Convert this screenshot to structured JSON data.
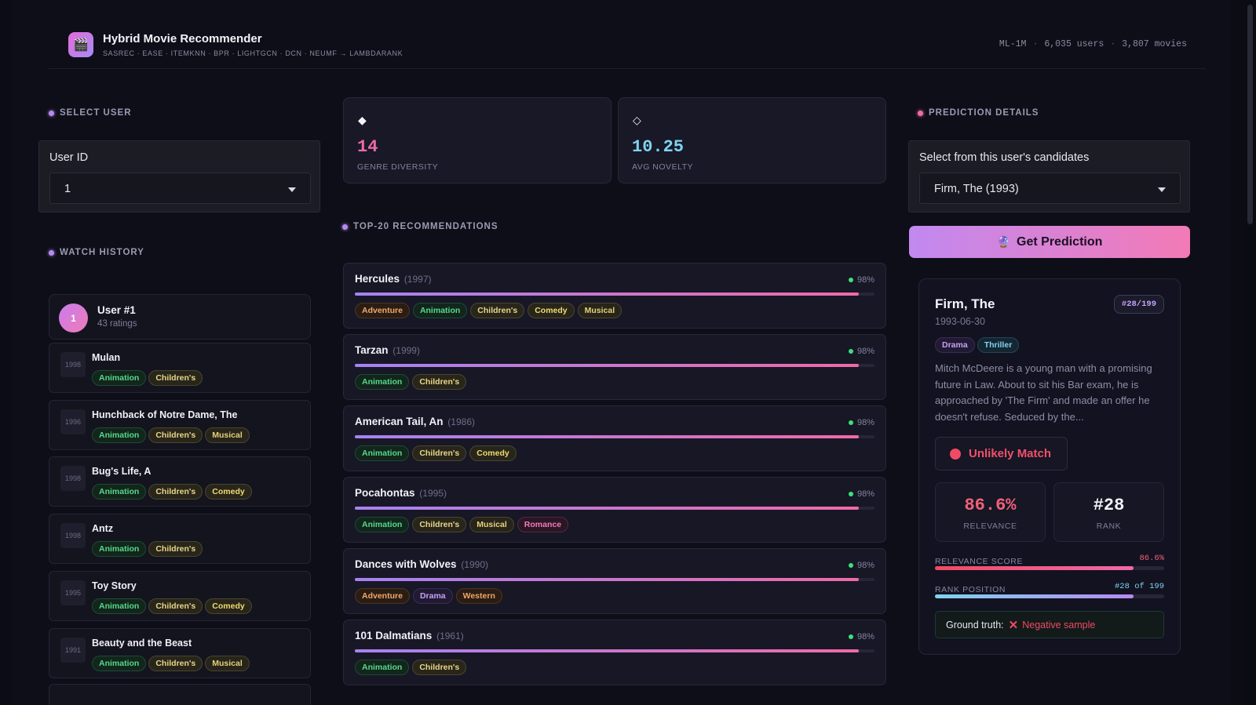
{
  "header": {
    "logo_icon": "clapper-board-icon",
    "title": "Hybrid Movie Recommender",
    "subtitle": "SASREC · EASE · ITEMKNN · BPR · LIGHTGCN · DCN · NEUMF → LAMBDARANK",
    "dataset": "ML-1M",
    "users": "6,035 users",
    "movies": "3,807 movies"
  },
  "left": {
    "select_user_label": "SELECT USER",
    "user_id_label": "User ID",
    "user_id_value": "1",
    "watch_history_label": "WATCH HISTORY",
    "user": {
      "avatar": "1",
      "name": "User #1",
      "ratings": "43 ratings"
    },
    "history": [
      {
        "year": "1998",
        "title": "Mulan",
        "tags": [
          "Animation",
          "Children's"
        ]
      },
      {
        "year": "1996",
        "title": "Hunchback of Notre Dame, The",
        "tags": [
          "Animation",
          "Children's",
          "Musical"
        ]
      },
      {
        "year": "1998",
        "title": "Bug's Life, A",
        "tags": [
          "Animation",
          "Children's",
          "Comedy"
        ]
      },
      {
        "year": "1998",
        "title": "Antz",
        "tags": [
          "Animation",
          "Children's"
        ]
      },
      {
        "year": "1995",
        "title": "Toy Story",
        "tags": [
          "Animation",
          "Children's",
          "Comedy"
        ]
      },
      {
        "year": "1991",
        "title": "Beauty and the Beast",
        "tags": [
          "Animation",
          "Children's",
          "Musical"
        ]
      }
    ]
  },
  "middle": {
    "metrics": [
      {
        "icon": "◆",
        "value": "14",
        "caption": "GENRE DIVERSITY",
        "color": "#f06aa8"
      },
      {
        "icon": "◇",
        "value": "10.25",
        "caption": "AVG NOVELTY",
        "color": "#7fd3f0"
      }
    ],
    "recs_label": "TOP-20 RECOMMENDATIONS",
    "recs": [
      {
        "title": "Hercules",
        "year": "(1997)",
        "score": "98%",
        "fill": 0.97,
        "tags": [
          "Adventure",
          "Animation",
          "Children's",
          "Comedy",
          "Musical"
        ]
      },
      {
        "title": "Tarzan",
        "year": "(1999)",
        "score": "98%",
        "fill": 0.97,
        "tags": [
          "Animation",
          "Children's"
        ]
      },
      {
        "title": "American Tail, An",
        "year": "(1986)",
        "score": "98%",
        "fill": 0.97,
        "tags": [
          "Animation",
          "Children's",
          "Comedy"
        ]
      },
      {
        "title": "Pocahontas",
        "year": "(1995)",
        "score": "98%",
        "fill": 0.97,
        "tags": [
          "Animation",
          "Children's",
          "Musical",
          "Romance"
        ]
      },
      {
        "title": "Dances with Wolves",
        "year": "(1990)",
        "score": "98%",
        "fill": 0.97,
        "tags": [
          "Adventure",
          "Drama",
          "Western"
        ]
      },
      {
        "title": "101 Dalmatians",
        "year": "(1961)",
        "score": "98%",
        "fill": 0.97,
        "tags": [
          "Animation",
          "Children's"
        ]
      }
    ]
  },
  "right": {
    "details_label": "PREDICTION DETAILS",
    "candidates_label": "Select from this user's candidates",
    "candidate_value": "Firm, The (1993)",
    "predict_button": "Get Prediction",
    "predict_icon": "crystal-ball-icon",
    "movie": {
      "title": "Firm, The",
      "date": "1993-06-30",
      "rank_badge": "#28/199",
      "tags": [
        "Drama",
        "Thriller"
      ],
      "description": "Mitch McDeere is a young man with a promising future in Law. About to sit his Bar exam, he is approached by 'The Firm' and made an offer he doesn't refuse. Seduced by the..."
    },
    "match": "Unlikely Match",
    "relevance_value": "86.6%",
    "relevance_caption": "RELEVANCE",
    "rank_value": "#28",
    "rank_caption": "RANK",
    "relevance_score_label": "RELEVANCE SCORE",
    "relevance_score_value": "86.6%",
    "relevance_fill": 0.866,
    "rank_position_label": "RANK POSITION",
    "rank_position_value": "#28 of 199",
    "rank_fill": 0.865,
    "ground_truth_label": "Ground truth:",
    "ground_truth_value": "Negative sample"
  },
  "colors": {
    "accent_purple": "#b58af0",
    "accent_pink": "#f06aa8",
    "negative_red": "#f04a64",
    "cyan": "#7fd3f0"
  }
}
